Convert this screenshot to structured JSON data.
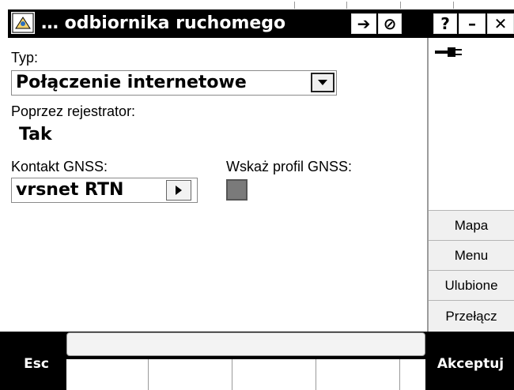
{
  "title_bar": {
    "title": "… odbiornika ruchomego",
    "buttons": [
      {
        "icon": "arrow-right-icon",
        "glyph": "➔"
      },
      {
        "icon": "no-entry-icon",
        "glyph": "⊘"
      },
      {
        "icon": "help-icon",
        "glyph": "?"
      },
      {
        "icon": "minimize-icon",
        "glyph": "–"
      },
      {
        "icon": "close-icon",
        "glyph": "✕"
      }
    ]
  },
  "form": {
    "type_label": "Typ:",
    "type_value": "Połączenie internetowe",
    "via_logger_label": "Poprzez rejestrator:",
    "via_logger_value": "Tak",
    "gnss_contact_label": "Kontakt GNSS:",
    "gnss_contact_value": "vrsnet RTN",
    "show_profile_label": "Wskaż profil GNSS:",
    "show_profile_checked": false
  },
  "side_panel": {
    "status_icon": "power-plug-icon",
    "buttons": [
      "Mapa",
      "Menu",
      "Ulubione",
      "Przełącz"
    ]
  },
  "bottom_bar": {
    "esc_label": "Esc",
    "accept_label": "Akceptuj",
    "status_text": ""
  },
  "colors": {
    "title_background": "#000000",
    "bottom_background": "#000000",
    "side_button_background": "#f0f0f0",
    "checkbox_fill": "#7a7a7a"
  }
}
